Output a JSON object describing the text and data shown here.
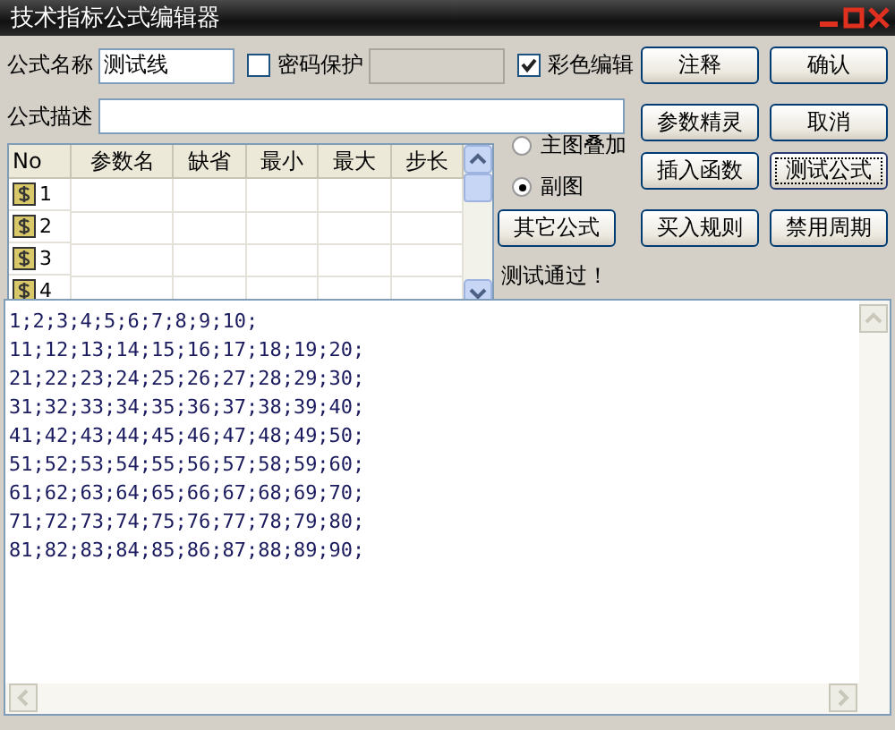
{
  "window": {
    "title": "技术指标公式编辑器"
  },
  "name_field": {
    "label": "公式名称",
    "value": "测试线"
  },
  "password_protect": {
    "label": "密码保护",
    "checked": false
  },
  "color_edit": {
    "label": "彩色编辑",
    "checked": true
  },
  "description_field": {
    "label": "公式描述"
  },
  "param_table": {
    "columns": [
      "No",
      "参数名",
      "缺省",
      "最小",
      "最大",
      "步长"
    ],
    "rows": [
      {
        "no": "1"
      },
      {
        "no": "2"
      },
      {
        "no": "3"
      },
      {
        "no": "4"
      }
    ]
  },
  "chart_mode": [
    {
      "label": "主图叠加",
      "selected": false
    },
    {
      "label": "副图",
      "selected": true
    }
  ],
  "buttons": [
    {
      "label": "注释",
      "focused": false
    },
    {
      "label": "确认",
      "focused": false
    },
    {
      "label": "参数精灵",
      "focused": false
    },
    {
      "label": "取消",
      "focused": false
    },
    {
      "label": "插入函数",
      "focused": false
    },
    {
      "label": "测试公式",
      "focused": true
    },
    {
      "label": "其它公式",
      "focused": false
    },
    {
      "label": "买入规则",
      "focused": false
    },
    {
      "label": "禁用周期",
      "focused": false
    }
  ],
  "status": "测试通过！",
  "editor": {
    "lines": [
      "1;2;3;4;5;6;7;8;9;10;",
      "11;12;13;14;15;16;17;18;19;20;",
      "21;22;23;24;25;26;27;28;29;30;",
      "31;32;33;34;35;36;37;38;39;40;",
      "41;42;43;44;45;46;47;48;49;50;",
      "51;52;53;54;55;56;57;58;59;60;",
      "61;62;63;64;65;66;67;68;69;70;",
      "71;72;73;74;75;76;77;78;79;80;",
      "81;82;83;84;85;86;87;88;89;90;"
    ]
  }
}
